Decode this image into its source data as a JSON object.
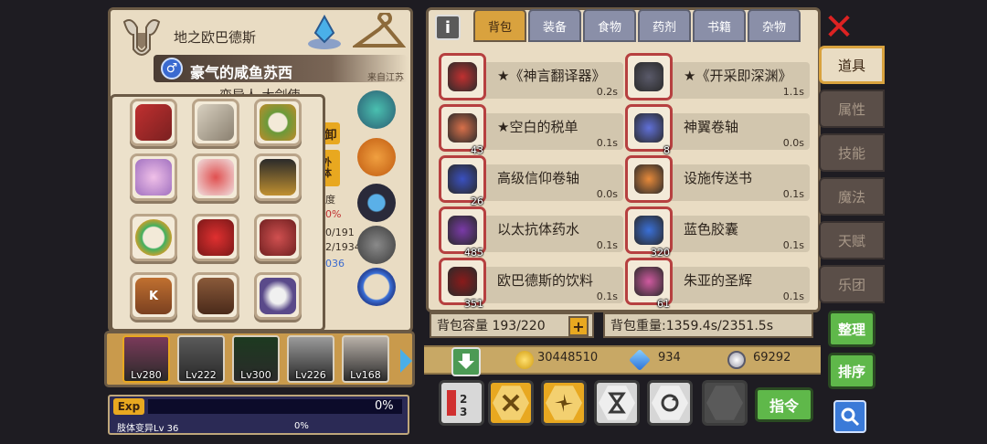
{
  "character": {
    "title": "地之欧巴德斯",
    "name": "豪气的咸鱼苏西",
    "gender_symbol": "♂",
    "origin": "来自江苏",
    "subtitle": "变异人 大剑使",
    "side_button_1": "卸",
    "side_button_2": "外体",
    "side_text": [
      "度",
      "0%",
      "0/191",
      "2/1934",
      "036"
    ]
  },
  "equipment_icons": [
    "crimson-sword-icon",
    "steel-sword-icon",
    "leaf-wreath-icon",
    "crystal-rabbit-icon",
    "rose-bouquet-icon",
    "dark-armor-icon",
    "jade-ring-icon",
    "ruby-chest-armor-icon",
    "demon-mask-icon",
    "k-boot-icon",
    "leather-boots-icon",
    "twin-drum-icon"
  ],
  "party": [
    {
      "level": "Lv280",
      "color": "#7a3a5a"
    },
    {
      "level": "Lv222",
      "color": "#5a5a5a"
    },
    {
      "level": "Lv300",
      "color": "#1d3a20"
    },
    {
      "level": "Lv226",
      "color": "#9a9a9a"
    },
    {
      "level": "Lv168",
      "color": "#b8b0a8"
    }
  ],
  "exp": {
    "label": "Exp",
    "percent": "0%",
    "mutation_label": "肢体变异Lv 36",
    "mutation_percent": "0%",
    "fill": 0
  },
  "tabs": [
    "背包",
    "装备",
    "食物",
    "药剂",
    "书籍",
    "杂物"
  ],
  "active_tab": 0,
  "items": [
    {
      "name": "★《神言翻译器》",
      "time": "0.2s",
      "count": "",
      "icon": "translator-device-icon",
      "color": "#c03030"
    },
    {
      "name": "★《开采即深渊》",
      "time": "1.1s",
      "count": "",
      "icon": "pickaxe-icon",
      "color": "#5a5a6a"
    },
    {
      "name": "★空白的税单",
      "time": "0.1s",
      "count": "43",
      "icon": "tax-form-icon",
      "color": "#d8704a"
    },
    {
      "name": "神翼卷轴",
      "time": "0.0s",
      "count": "8",
      "icon": "wing-scroll-icon",
      "color": "#6070d8"
    },
    {
      "name": "高级信仰卷轴",
      "time": "0.0s",
      "count": "26",
      "icon": "faith-scroll-icon",
      "color": "#3a50c0"
    },
    {
      "name": "设施传送书",
      "time": "0.1s",
      "count": "",
      "icon": "teleport-book-icon",
      "color": "#e88a3a"
    },
    {
      "name": "以太抗体药水",
      "time": "0.1s",
      "count": "485",
      "icon": "ether-potion-icon",
      "color": "#7a3aa8"
    },
    {
      "name": "蓝色胶囊",
      "time": "0.1s",
      "count": "320",
      "icon": "blue-capsule-icon",
      "color": "#3a70d8"
    },
    {
      "name": "欧巴德斯的饮料",
      "time": "0.1s",
      "count": "351",
      "icon": "drink-bottle-icon",
      "color": "#8a1a1a"
    },
    {
      "name": "朱亚的圣辉",
      "time": "0.1s",
      "count": "61",
      "icon": "holy-potion-icon",
      "color": "#d05aa0"
    }
  ],
  "capacity": "背包容量 193/220",
  "weight": "背包重量:1359.4s/2351.5s",
  "currency": {
    "gold": "30448510",
    "diamond": "934",
    "silver": "69292"
  },
  "command_label": "指令",
  "side_menu": [
    "道具",
    "属性",
    "技能",
    "魔法",
    "天赋",
    "乐团"
  ],
  "organize_label": "整理",
  "sort_label": "排序",
  "colors": {
    "accent": "#e8a820",
    "panel": "#e9dcc3",
    "border": "#6b5a45",
    "green": "#5fb84a"
  }
}
